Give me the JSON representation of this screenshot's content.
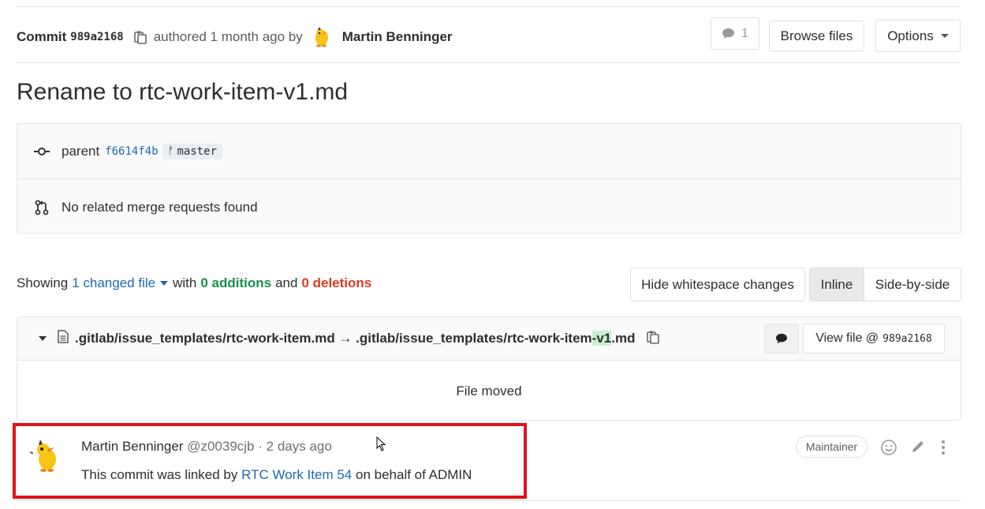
{
  "header": {
    "commit_label": "Commit",
    "commit_sha": "989a2168",
    "authored_text": "authored 1 month ago by",
    "author_name": "Martin Benninger",
    "comments_count": "1",
    "browse_files_label": "Browse files",
    "options_label": "Options"
  },
  "title": "Rename to rtc-work-item-v1.md",
  "info": {
    "parent_label": "parent",
    "parent_sha": "f6614f4b",
    "branch": "master",
    "merge_requests_text": "No related merge requests found"
  },
  "diff_stats": {
    "showing": "Showing",
    "changed_files": "1 changed file",
    "with": "with",
    "additions": "0 additions",
    "and": "and",
    "deletions": "0 deletions"
  },
  "view_controls": {
    "hide_whitespace_label": "Hide whitespace changes",
    "inline_label": "Inline",
    "side_by_side_label": "Side-by-side"
  },
  "file": {
    "old_path": ".gitlab/issue_templates/rtc-work-item.md",
    "arrow": "→",
    "new_path_prefix": ".gitlab/issue_templates/rtc-work-item",
    "new_path_highlight": "-v1",
    "new_path_suffix": ".md",
    "view_file_label": "View file @",
    "view_file_sha": "989a2168",
    "status_text": "File moved"
  },
  "note": {
    "author_name": "Martin Benninger",
    "author_username": "@z0039cjb",
    "separator": "·",
    "time": "2 days ago",
    "body_prefix": "This commit was linked by",
    "body_link": "RTC Work Item 54",
    "body_suffix": "on behalf of ADMIN",
    "role_badge": "Maintainer"
  },
  "colors": {
    "link": "#1b69b6",
    "additions": "#168f48",
    "deletions": "#db3b21",
    "highlight_box": "#e3121b"
  }
}
